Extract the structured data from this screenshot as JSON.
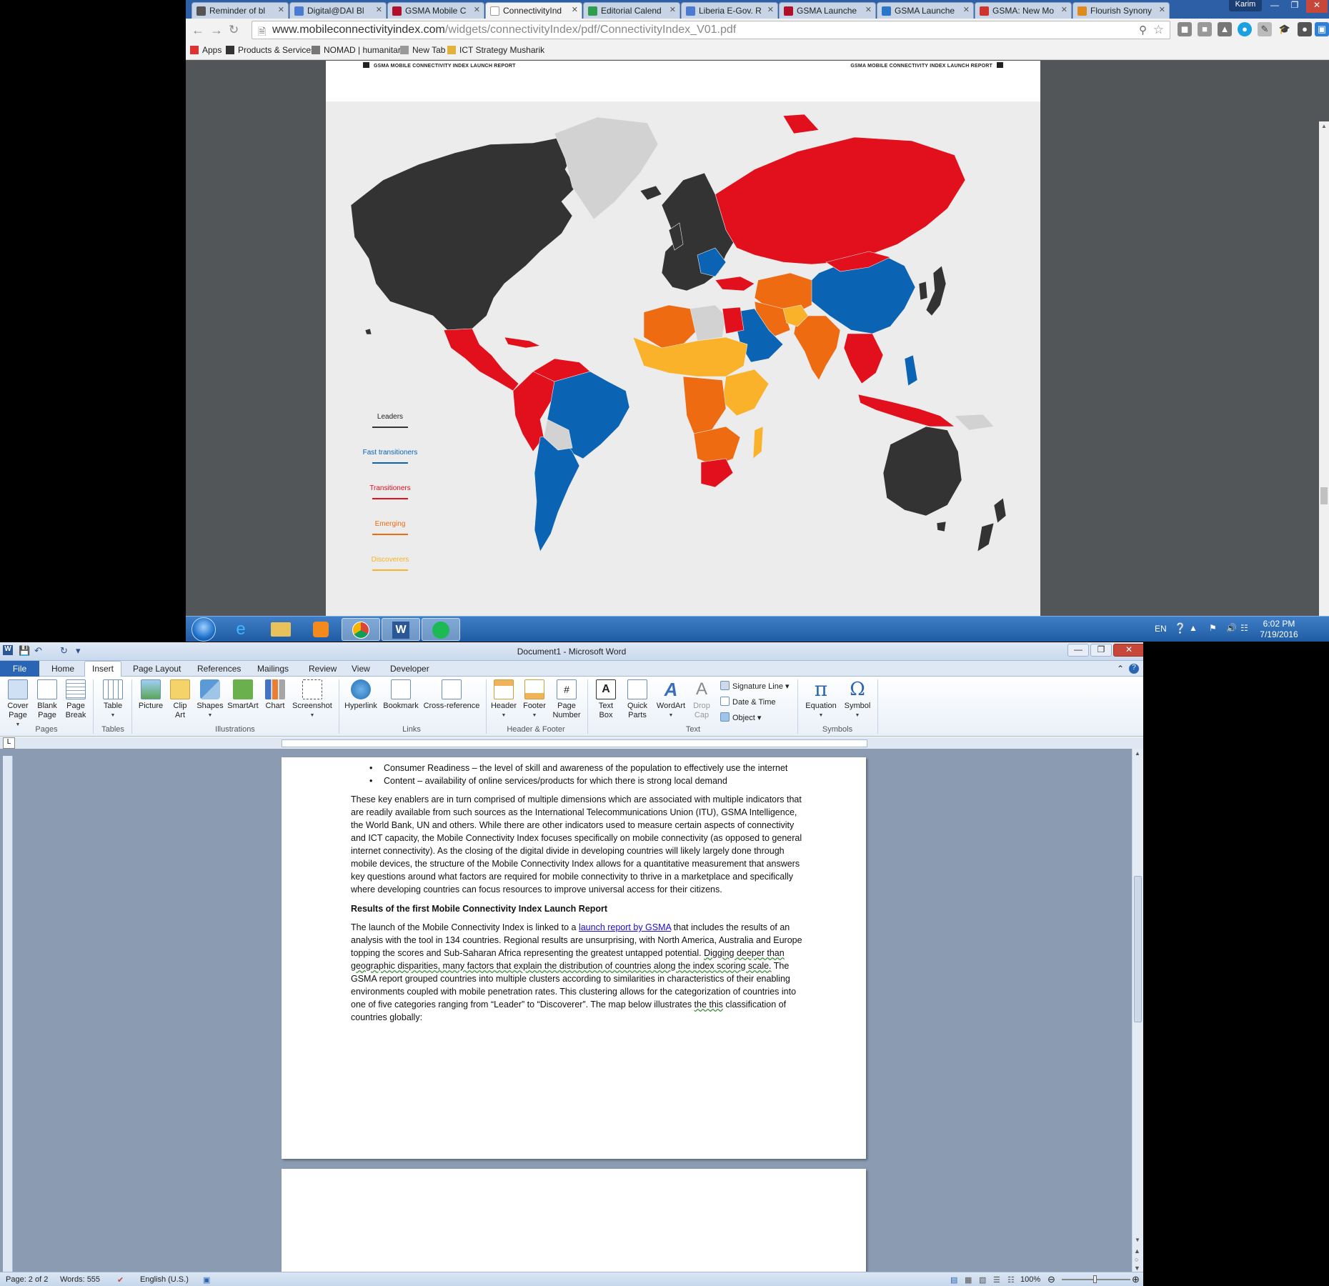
{
  "browser": {
    "tabs": [
      {
        "title": "Reminder of bl",
        "color": "#555555"
      },
      {
        "title": "Digital@DAI Bl",
        "color": "#4a7bd0"
      },
      {
        "title": "GSMA Mobile C",
        "color": "#b0102a"
      },
      {
        "title": "ConnectivityInd",
        "color": "#ffffff"
      },
      {
        "title": "Editorial Calend",
        "color": "#2e9d4d"
      },
      {
        "title": "Liberia E-Gov. R",
        "color": "#4a7bd0"
      },
      {
        "title": "GSMA Launche",
        "color": "#b0102a"
      },
      {
        "title": "GSMA Launche",
        "color": "#2a77c9"
      },
      {
        "title": "GSMA: New Mo",
        "color": "#d0332b"
      },
      {
        "title": "Flourish Synony",
        "color": "#e08a1e"
      }
    ],
    "profile": "Karim",
    "url_domain": "www.mobileconnectivityindex.com",
    "url_path": "/widgets/connectivityIndex/pdf/ConnectivityIndex_V01.pdf",
    "bookmarks": [
      {
        "label": "Apps",
        "color": "#d33"
      },
      {
        "label": "Products & Services",
        "color": "#333"
      },
      {
        "label": "NOMAD | humanitaria",
        "color": "#777"
      },
      {
        "label": "New Tab",
        "color": "#999"
      },
      {
        "label": "ICT Strategy Musharik",
        "color": "#e2b33c"
      }
    ]
  },
  "pdf": {
    "header_left": "GSMA MOBILE CONNECTIVITY INDEX LAUNCH REPORT",
    "header_right": "GSMA MOBILE CONNECTIVITY INDEX LAUNCH REPORT",
    "legend": [
      {
        "label": "Leaders",
        "color": "#333333"
      },
      {
        "label": "Fast transitioners",
        "color": "#0b63b3"
      },
      {
        "label": "Transitioners",
        "color": "#e2101d"
      },
      {
        "label": "Emerging",
        "color": "#ee6b12"
      },
      {
        "label": "Discoverers",
        "color": "#f9b22a"
      }
    ],
    "colors": {
      "none": "#d2d2d2",
      "ocean": "#ececec"
    }
  },
  "taskbar": {
    "language": "EN",
    "time": "6:02 PM",
    "date": "7/19/2016"
  },
  "word": {
    "title": "Document1  -  Microsoft Word",
    "tabs": [
      "File",
      "Home",
      "Insert",
      "Page Layout",
      "References",
      "Mailings",
      "Review",
      "View",
      "Developer"
    ],
    "ribbon": {
      "cover_page": "Cover\nPage",
      "blank_page": "Blank\nPage",
      "page_break": "Page\nBreak",
      "table": "Table",
      "picture": "Picture",
      "clip_art": "Clip\nArt",
      "shapes": "Shapes",
      "smartart": "SmartArt",
      "chart": "Chart",
      "screenshot": "Screenshot",
      "hyperlink": "Hyperlink",
      "bookmark": "Bookmark",
      "cross_reference": "Cross-reference",
      "header": "Header",
      "footer": "Footer",
      "page_number": "Page\nNumber",
      "text_box": "Text\nBox",
      "quick_parts": "Quick\nParts",
      "wordart": "WordArt",
      "drop_cap": "Drop\nCap",
      "signature_line": "Signature Line",
      "date_time": "Date & Time",
      "object": "Object",
      "equation": "Equation",
      "symbol": "Symbol",
      "groups": [
        "Pages",
        "Tables",
        "Illustrations",
        "Links",
        "Header & Footer",
        "Text",
        "Symbols"
      ]
    },
    "document": {
      "bullets": [
        "Consumer Readiness – the level of skill and awareness of the population to effectively use the internet",
        "Content – availability of online services/products for which there is strong local demand"
      ],
      "para1": "These key enablers are in turn comprised of multiple dimensions which are associated with multiple indicators that are readily available from such sources as the International Telecommunications Union (ITU), GSMA Intelligence, the World Bank, UN and others. While there are other indicators used to measure certain aspects of connectivity and ICT capacity,  the Mobile Connectivity Index focuses specifically on mobile connectivity (as opposed to general internet connectivity). As the closing of the digital divide in developing countries will likely largely done through mobile devices, the structure of the Mobile Connectivity Index allows for a quantitative measurement that answers key questions around what factors are required for mobile connectivity to thrive in a marketplace and specifically where developing countries can focus resources to improve universal access for their citizens.",
      "heading": "Results of the first Mobile Connectivity Index Launch Report",
      "para2_a": "The launch of the Mobile Connectivity Index is linked to a ",
      "para2_link": "launch report by GSMA",
      "para2_b": " that includes the results of an analysis with the tool in 134  countries. Regional results are unsurprising, with North America, Australia and Europe topping the scores and Sub-Saharan Africa representing the greatest untapped potential. ",
      "para2_wavy": "Digging deeper than geographic disparities, many factors that explain the distribution of countries along the index scoring scale.",
      "para2_c": " The GSMA report grouped countries into multiple clusters according to similarities in characteristics of their enabling environments coupled with mobile penetration rates. This clustering allows for the categorization of countries into one of five categories ranging from “Leader” to “Discoverer”. The map below illustrates ",
      "para2_wavy2": "the this",
      "para2_d": " classification of countries globally:"
    },
    "status": {
      "page": "Page: 2 of 2",
      "words": "Words: 555",
      "language": "English (U.S.)",
      "zoom": "100%"
    }
  }
}
